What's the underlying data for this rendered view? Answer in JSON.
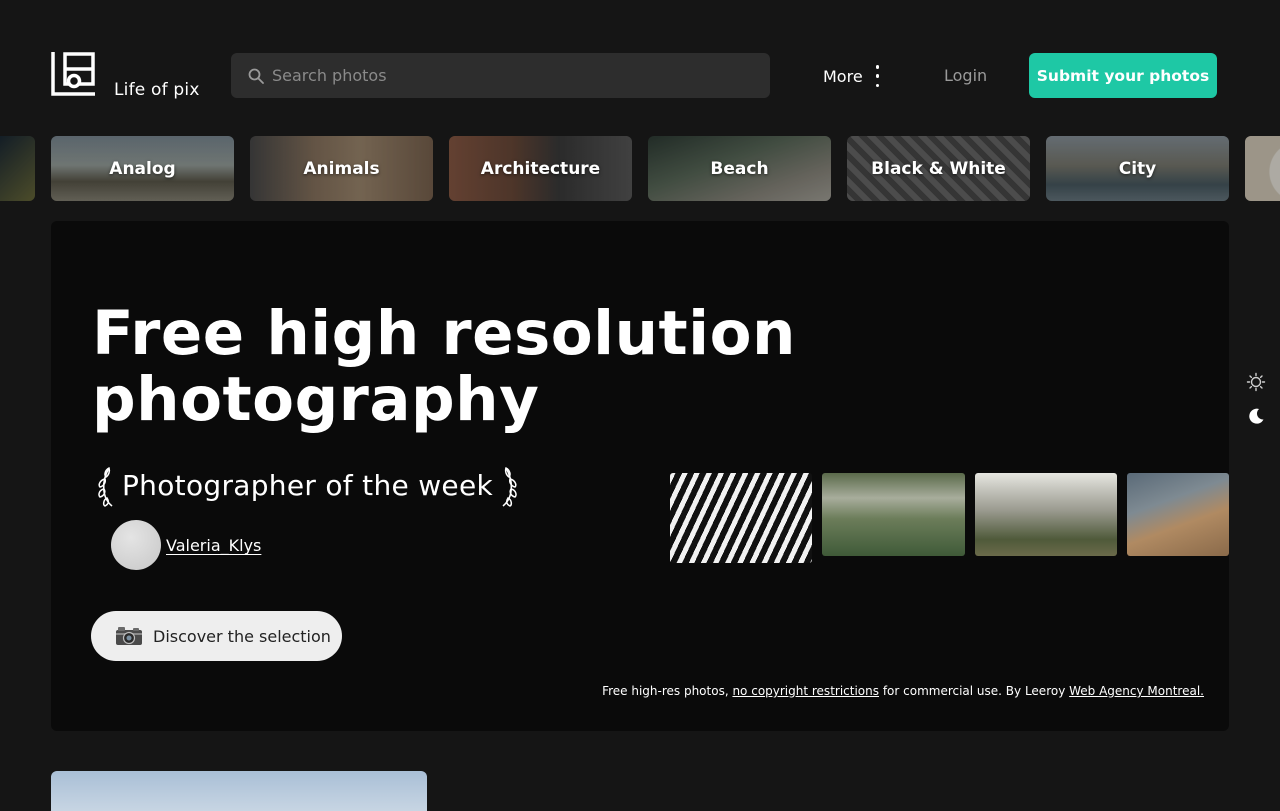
{
  "header": {
    "logo_text": "Life of pix",
    "search_placeholder": "Search photos",
    "more_label": "More",
    "login_label": "Login",
    "submit_label": "Submit your photos"
  },
  "categories": [
    "Analog",
    "Animals",
    "Architecture",
    "Beach",
    "Black & White",
    "City"
  ],
  "hero": {
    "title": "Free high resolution photography",
    "photographer_of_week_label": "Photographer of the week",
    "photographer_name": "Valeria_Klys",
    "discover_label": "Discover the selection",
    "footer_text_1": "Free high-res photos, ",
    "footer_link_1": "no copyright restrictions",
    "footer_text_2": " for commercial use. By Leeroy ",
    "footer_link_2": "Web Agency Montreal."
  },
  "colors": {
    "background": "#151515",
    "hero_background": "#0a0a0a",
    "accent": "#1ec8a5",
    "search_background": "#2d2d2d"
  },
  "icons": {
    "logo": "life-of-pix-logo-icon",
    "search": "search-icon",
    "more": "vertical-dots-icon",
    "laurel": "laurel-icon",
    "camera": "camera-icon",
    "sun": "sun-icon",
    "moon": "moon-icon"
  }
}
